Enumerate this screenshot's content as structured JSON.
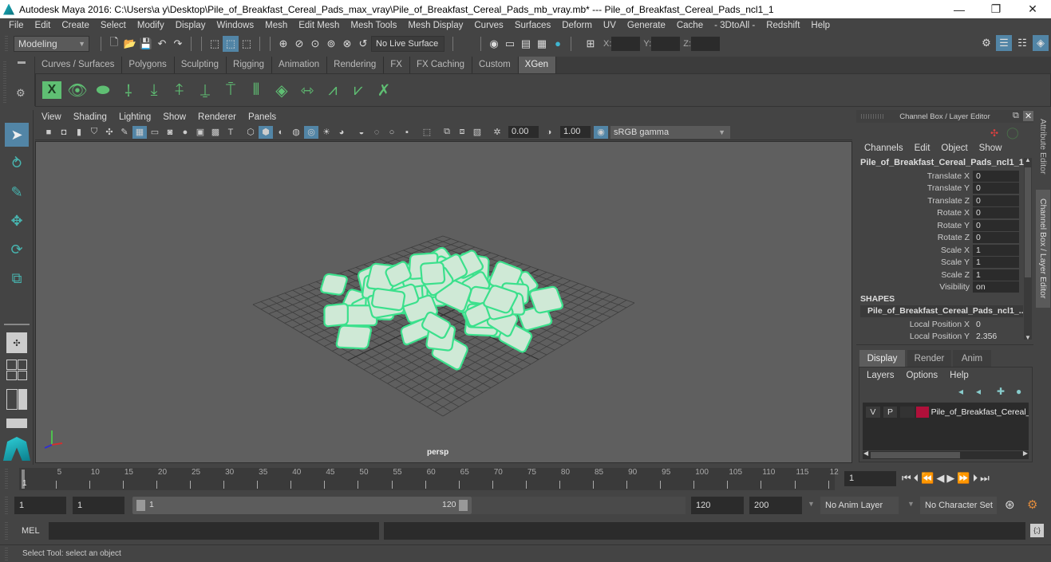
{
  "window": {
    "title": "Autodesk Maya 2016: C:\\Users\\a y\\Desktop\\Pile_of_Breakfast_Cereal_Pads_max_vray\\Pile_of_Breakfast_Cereal_Pads_mb_vray.mb*   ---   Pile_of_Breakfast_Cereal_Pads_ncl1_1",
    "minimize": "—",
    "restore": "❐",
    "close": "✕"
  },
  "menubar": [
    "File",
    "Edit",
    "Create",
    "Select",
    "Modify",
    "Display",
    "Windows",
    "Mesh",
    "Edit Mesh",
    "Mesh Tools",
    "Mesh Display",
    "Curves",
    "Surfaces",
    "Deform",
    "UV",
    "Generate",
    "Cache",
    "- 3DtoAll -",
    "Redshift",
    "Help"
  ],
  "statusline": {
    "mode_menu": "Modeling",
    "live_surface": "No Live Surface",
    "x_label": "X:",
    "y_label": "Y:",
    "z_label": "Z:",
    "x_value": "",
    "y_value": "",
    "z_value": ""
  },
  "shelf": {
    "tabs": [
      "Curves / Surfaces",
      "Polygons",
      "Sculpting",
      "Rigging",
      "Animation",
      "Rendering",
      "FX",
      "FX Caching",
      "Custom",
      "XGen"
    ],
    "active_tab": "XGen",
    "icons": [
      "xgen-editor-icon",
      "xgen-preview-icon",
      "xgen-clear-preview-icon",
      "add-guides-icon",
      "place-guides-icon",
      "add-guide-icon",
      "show-guides-icon",
      "lock-guides-icon",
      "guides-icon",
      "collection-icon",
      "guide-length-icon",
      "select-guides-icon",
      "guide-cv-icon",
      "delete-guides-icon"
    ]
  },
  "viewport": {
    "menu": [
      "View",
      "Shading",
      "Lighting",
      "Show",
      "Renderer",
      "Panels"
    ],
    "exposure": "0.00",
    "gamma": "1.00",
    "color_space": "sRGB gamma",
    "camera_label": "persp"
  },
  "channel_box": {
    "header": "Channel Box / Layer Editor",
    "menu": [
      "Channels",
      "Edit",
      "Object",
      "Show"
    ],
    "object_name": "Pile_of_Breakfast_Cereal_Pads_ncl1_1",
    "channels": [
      {
        "label": "Translate X",
        "value": "0"
      },
      {
        "label": "Translate Y",
        "value": "0"
      },
      {
        "label": "Translate Z",
        "value": "0"
      },
      {
        "label": "Rotate X",
        "value": "0"
      },
      {
        "label": "Rotate Y",
        "value": "0"
      },
      {
        "label": "Rotate Z",
        "value": "0"
      },
      {
        "label": "Scale X",
        "value": "1"
      },
      {
        "label": "Scale Y",
        "value": "1"
      },
      {
        "label": "Scale Z",
        "value": "1"
      },
      {
        "label": "Visibility",
        "value": "on"
      }
    ],
    "shapes_header": "SHAPES",
    "shape_name": "Pile_of_Breakfast_Cereal_Pads_ncl1_...",
    "shape_channels": [
      {
        "label": "Local Position X",
        "value": "0"
      },
      {
        "label": "Local Position Y",
        "value": "2.356"
      }
    ]
  },
  "side_tabs": [
    "Attribute Editor",
    "Channel Box / Layer Editor"
  ],
  "layer_editor": {
    "tabs": [
      "Display",
      "Render",
      "Anim"
    ],
    "active_tab": "Display",
    "menu": [
      "Layers",
      "Options",
      "Help"
    ],
    "layers": [
      {
        "v": "V",
        "p": "P",
        "name": "Pile_of_Breakfast_Cereal_",
        "color": "#b0103a"
      }
    ]
  },
  "timeline": {
    "ticks": [
      "5",
      "10",
      "15",
      "20",
      "25",
      "30",
      "35",
      "40",
      "45",
      "50",
      "55",
      "60",
      "65",
      "70",
      "75",
      "80",
      "85",
      "90",
      "95",
      "100",
      "105",
      "110",
      "115",
      "12"
    ],
    "current_frame_marker": "1",
    "current_frame": "1"
  },
  "range": {
    "start": "1",
    "playback_start": "1",
    "slider_start": "1",
    "slider_end": "120",
    "playback_end": "120",
    "end": "200",
    "anim_layer": "No Anim Layer",
    "character_set": "No Character Set"
  },
  "command_line": {
    "label": "MEL",
    "value": ""
  },
  "help_line": "Select Tool: select an object"
}
